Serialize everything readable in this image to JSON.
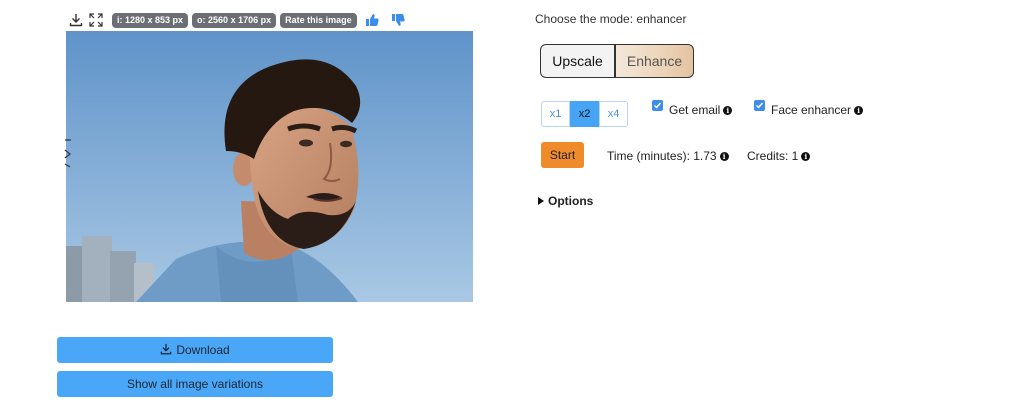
{
  "toolbar": {
    "icons": [
      "download-icon",
      "fullscreen-icon"
    ],
    "input_size": "i: 1280 x 853 px",
    "output_size": "o: 2560 x 1706 px",
    "rate_label": "Rate this image",
    "thumb_up": "thumbs-up-icon",
    "thumb_down": "thumbs-down-icon"
  },
  "image": {
    "subject": "portrait-photo"
  },
  "buttons": {
    "download_label": "Download",
    "variations_label": "Show all image variations"
  },
  "mode": {
    "title": "Choose the mode: enhancer",
    "options": [
      "Upscale",
      "Enhance"
    ],
    "selected": "Enhance"
  },
  "scale": {
    "options": [
      "x1",
      "x2",
      "x4"
    ],
    "selected": "x2"
  },
  "checkboxes": {
    "get_email": {
      "label": "Get email",
      "checked": true
    },
    "face_enhancer": {
      "label": "Face enhancer",
      "checked": true
    }
  },
  "run": {
    "start_label": "Start",
    "time_label": "Time (minutes): 1.73",
    "credits_label": "Credits: 1"
  },
  "options_label": "Options",
  "colors": {
    "primary_button": "#4aa7f7",
    "start_button": "#f08b2c",
    "chip": "#6b6e73",
    "checkbox": "#3d8ee8"
  }
}
